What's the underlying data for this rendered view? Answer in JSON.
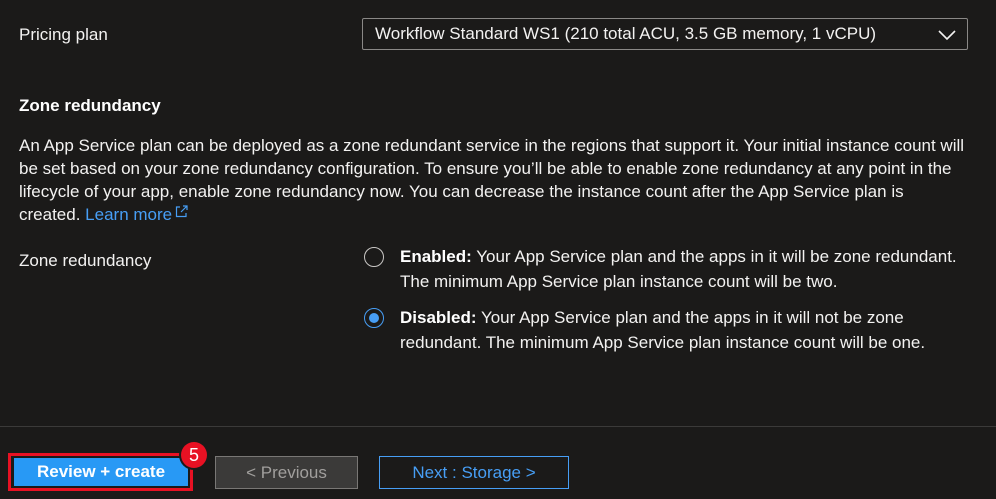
{
  "pricing": {
    "label": "Pricing plan",
    "selected_value": "Workflow Standard WS1 (210 total ACU, 3.5 GB memory, 1 vCPU)"
  },
  "zone_section": {
    "title": "Zone redundancy",
    "description": "An App Service plan can be deployed as a zone redundant service in the regions that support it. Your initial instance count will be set based on your zone redundancy configuration. To ensure you’ll be able to enable zone redundancy at any point in the lifecycle of your app, enable zone redundancy now. You can decrease the instance count after the App Service plan is created.",
    "learn_more": "Learn more",
    "field_label": "Zone redundancy",
    "options": [
      {
        "title": "Enabled:",
        "text": "Your App Service plan and the apps in it will be zone redundant. The minimum App Service plan instance count will be two.",
        "checked": false
      },
      {
        "title": "Disabled:",
        "text": "Your App Service plan and the apps in it will not be zone redundant. The minimum App Service plan instance count will be one.",
        "checked": true
      }
    ]
  },
  "footer": {
    "review_create_label": "Review + create",
    "previous_label": "< Previous",
    "next_label": "Next : Storage >",
    "step_badge": "5"
  },
  "colors": {
    "background": "#1b1a19",
    "accent": "#479ef5",
    "primary_button": "#2899f5",
    "highlight_red": "#e81123"
  },
  "icons": {
    "dropdown": "chevron-down-icon",
    "external_link": "external-link-icon"
  }
}
